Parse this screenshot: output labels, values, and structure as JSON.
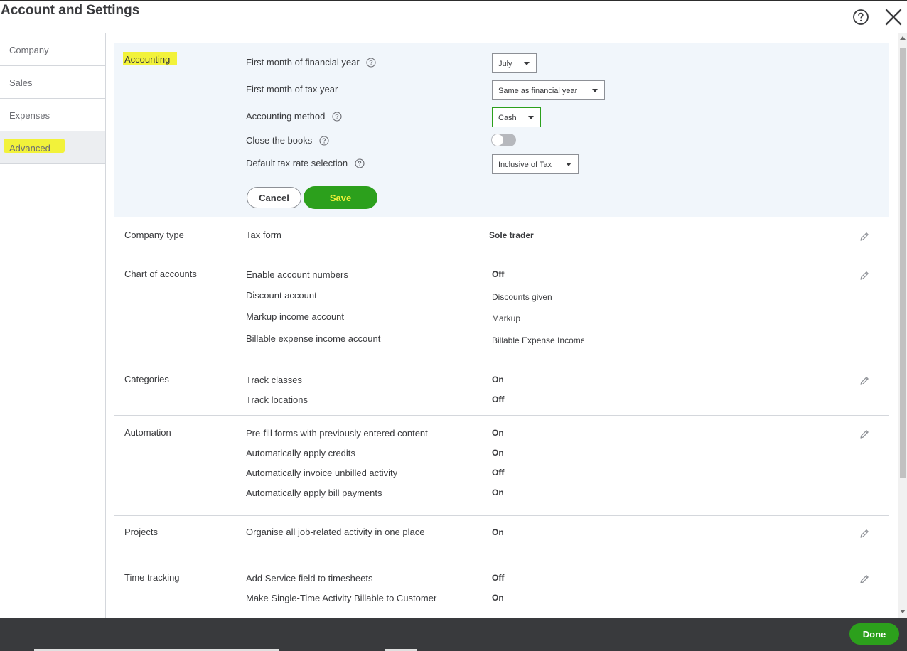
{
  "page": {
    "title": "Account and Settings"
  },
  "sidebar": {
    "items": [
      {
        "label": "Company"
      },
      {
        "label": "Sales"
      },
      {
        "label": "Expenses"
      },
      {
        "label": "Advanced"
      }
    ],
    "active_index": 3
  },
  "accounting": {
    "label": "Accounting",
    "first_month_fy_label": "First month of financial year",
    "first_month_fy_value": "July",
    "first_month_tax_label": "First month of tax year",
    "first_month_tax_value": "Same as financial year",
    "accounting_method_label": "Accounting method",
    "accounting_method_value": "Cash",
    "close_books_label": "Close the books",
    "default_tax_label": "Default tax rate selection",
    "default_tax_value": "Inclusive of Tax",
    "cancel_label": "Cancel",
    "save_label": "Save"
  },
  "company_type": {
    "label": "Company type",
    "rows": [
      {
        "label": "Tax form",
        "value": "Sole trader"
      }
    ]
  },
  "chart_of_accounts": {
    "label": "Chart of accounts",
    "rows": [
      {
        "label": "Enable account numbers",
        "value": "Off"
      },
      {
        "label": "Discount account",
        "value": "Discounts given"
      },
      {
        "label": "Markup income account",
        "value": "Markup"
      },
      {
        "label": "Billable expense income account",
        "value": "Billable Expense Income"
      }
    ]
  },
  "categories": {
    "label": "Categories",
    "rows": [
      {
        "label": "Track classes",
        "value": "On"
      },
      {
        "label": "Track locations",
        "value": "Off"
      }
    ]
  },
  "automation": {
    "label": "Automation",
    "rows": [
      {
        "label": "Pre-fill forms with previously entered content",
        "value": "On"
      },
      {
        "label": "Automatically apply credits",
        "value": "On"
      },
      {
        "label": "Automatically invoice unbilled activity",
        "value": "Off"
      },
      {
        "label": "Automatically apply bill payments",
        "value": "On"
      }
    ]
  },
  "projects": {
    "label": "Projects",
    "rows": [
      {
        "label": "Organise all job-related activity in one place",
        "value": "On"
      }
    ]
  },
  "time_tracking": {
    "label": "Time tracking",
    "rows": [
      {
        "label": "Add Service field to timesheets",
        "value": "Off"
      },
      {
        "label": "Make Single-Time Activity Billable to Customer",
        "value": "On"
      }
    ]
  },
  "footer": {
    "done_label": "Done"
  },
  "colors": {
    "green": "#2ca01c",
    "highlight": "#f2f23a",
    "panel": "#f1f6fb",
    "footer": "#393a3d"
  }
}
